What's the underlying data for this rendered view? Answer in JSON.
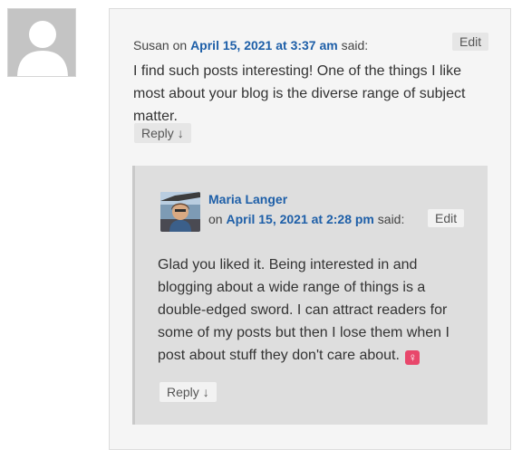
{
  "parent_comment": {
    "author": "Susan",
    "on_word": "on",
    "date_link": "April 15, 2021 at 3:37 am",
    "said_word": "said:",
    "edit_label": "Edit",
    "text": "I find such posts interesting! One of the things I like most about your blog is the diverse range of subject matter.",
    "reply_label": "Reply",
    "reply_arrow": "↓",
    "avatar_icon": "default-person-avatar"
  },
  "child_comment": {
    "author": "Maria Langer",
    "on_word": "on",
    "date_link": "April 15, 2021 at 2:28 pm",
    "said_word": "said:",
    "edit_label": "Edit",
    "text": "Glad you liked it. Being interested in and blogging about a wide range of things is a double-edged sword. I can attract readers for some of my posts but then I lose them when I post about stuff they don't care about.",
    "emoji": "♀",
    "reply_label": "Reply",
    "reply_arrow": "↓",
    "avatar_icon": "user-photo-avatar"
  },
  "colors": {
    "link": "#1e5fa8",
    "parent_bg": "#f5f5f5",
    "child_bg": "#dedede",
    "emoji_bg": "#e8476b"
  }
}
